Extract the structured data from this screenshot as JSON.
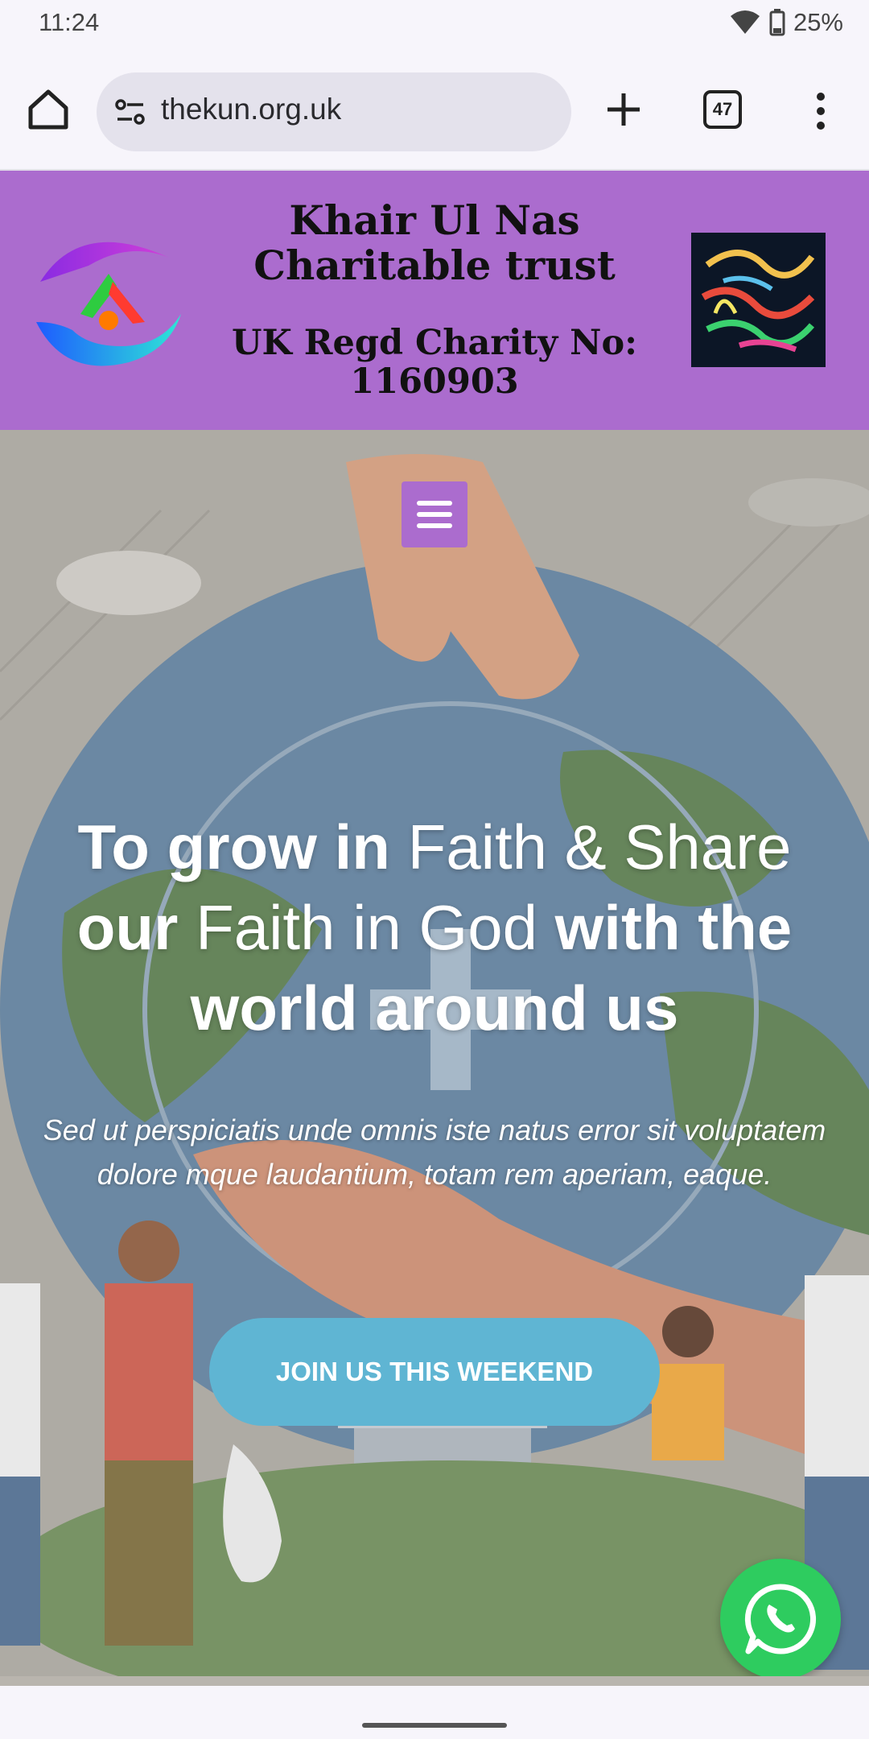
{
  "status_bar": {
    "time": "11:24",
    "battery": "25%"
  },
  "browser": {
    "url": "thekun.org.uk",
    "tab_count": "47"
  },
  "site_header": {
    "title": "Khair Ul Nas Charitable trust",
    "registration": "UK Regd Charity No: 1160903"
  },
  "hero": {
    "headline_1_bold": "To grow in ",
    "headline_1_light": "Faith & Share",
    "headline_2_bold": "our ",
    "headline_2_light": "Faith in God ",
    "headline_2_bold2": "with the",
    "headline_3_bold": "world around us",
    "subtext": "Sed ut perspiciatis unde omnis iste natus error sit voluptatem dolore mque laudantium, totam rem aperiam, eaque.",
    "cta_label": "JOIN US THIS WEEKEND"
  },
  "colors": {
    "header_bg": "#ab6cce",
    "cta_bg": "#5fb5d3",
    "whatsapp_bg": "#2ecc5f"
  },
  "icons": [
    "home-icon",
    "site-settings-icon",
    "plus-icon",
    "tabs-icon",
    "more-vert-icon",
    "menu-icon",
    "whatsapp-icon",
    "wifi-icon",
    "battery-icon"
  ]
}
